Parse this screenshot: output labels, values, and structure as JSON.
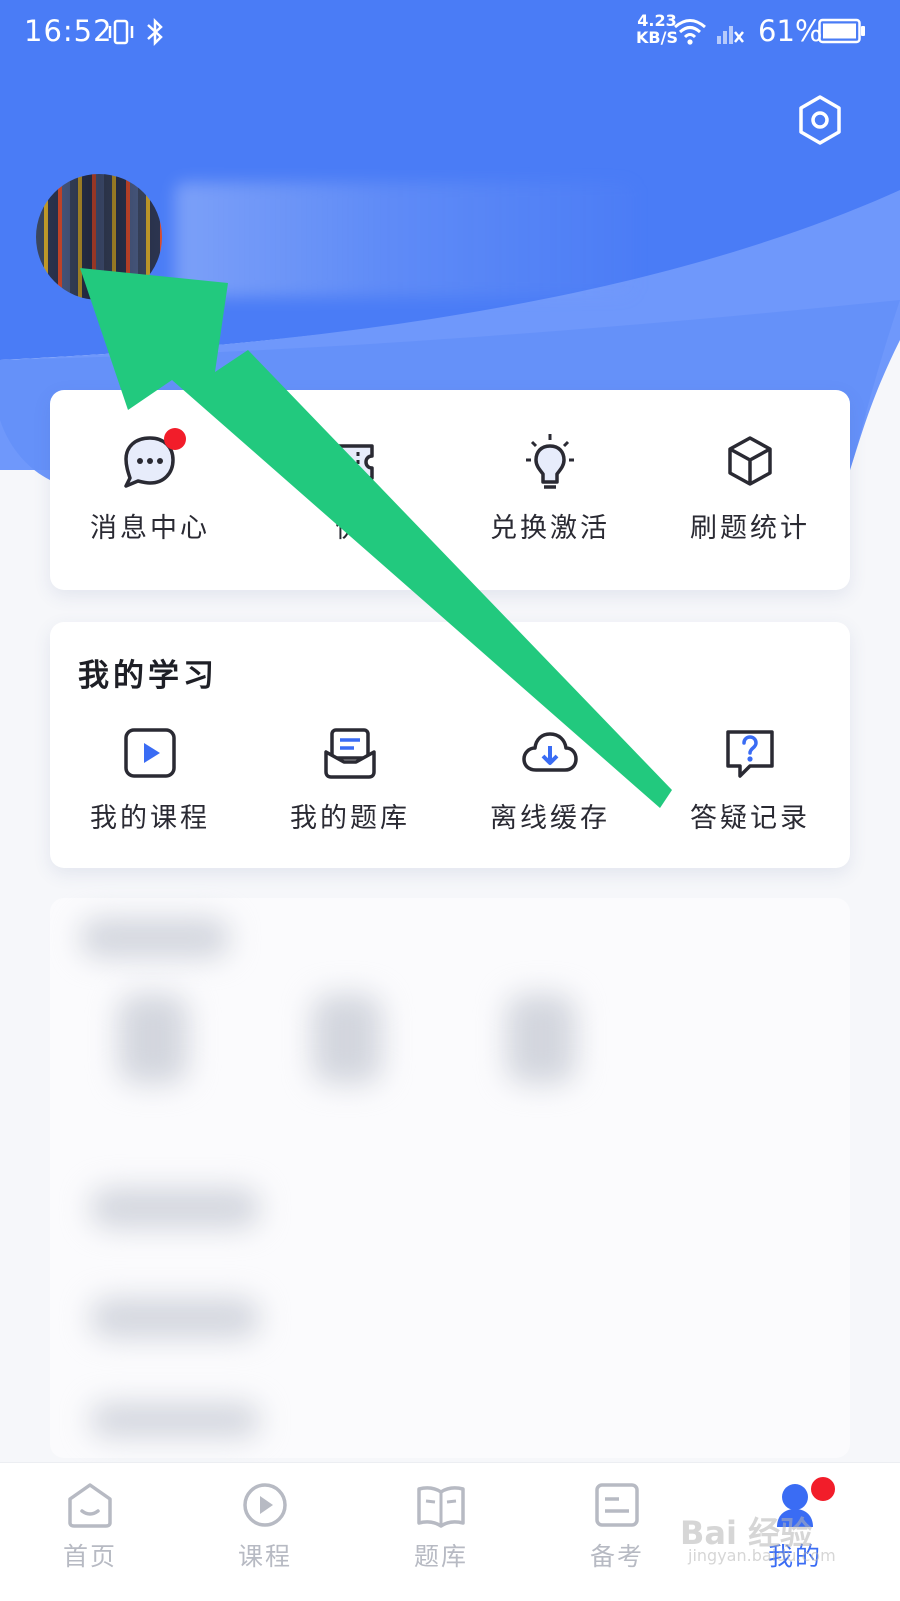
{
  "status_bar": {
    "time": "16:52",
    "net_speed_value": "4.23",
    "net_speed_unit": "KB/S",
    "battery": "61%"
  },
  "header": {
    "settings_icon": "settings-hexagon-icon"
  },
  "quick_actions": [
    {
      "label": "消息中心",
      "icon": "chat-bubble-icon",
      "badge": true
    },
    {
      "label": "优",
      "icon": "ticket-icon",
      "badge": false
    },
    {
      "label": "兑换激活",
      "icon": "lightbulb-icon",
      "badge": false
    },
    {
      "label": "刷题统计",
      "icon": "cube-icon",
      "badge": false
    }
  ],
  "my_study": {
    "title": "我的学习",
    "items": [
      {
        "label": "我的课程",
        "icon": "play-box-icon"
      },
      {
        "label": "我的题库",
        "icon": "question-bank-icon"
      },
      {
        "label": "离线缓存",
        "icon": "cloud-download-icon"
      },
      {
        "label": "答疑记录",
        "icon": "question-bubble-icon"
      }
    ]
  },
  "bottom_nav": [
    {
      "label": "首页",
      "icon": "home-icon",
      "active": false
    },
    {
      "label": "课程",
      "icon": "play-circle-icon",
      "active": false
    },
    {
      "label": "题库",
      "icon": "book-icon",
      "active": false
    },
    {
      "label": "备考",
      "icon": "notes-icon",
      "active": false
    },
    {
      "label": "我的",
      "icon": "profile-icon",
      "active": true,
      "badge": true
    }
  ],
  "watermark": {
    "main": "Bai 经验",
    "sub": "jingyan.baidu.com"
  },
  "colors": {
    "header_blue": "#4a7cf6",
    "accent_blue": "#3a6cf4",
    "badge_red": "#f21d2a",
    "arrow_green": "#22c97e"
  }
}
